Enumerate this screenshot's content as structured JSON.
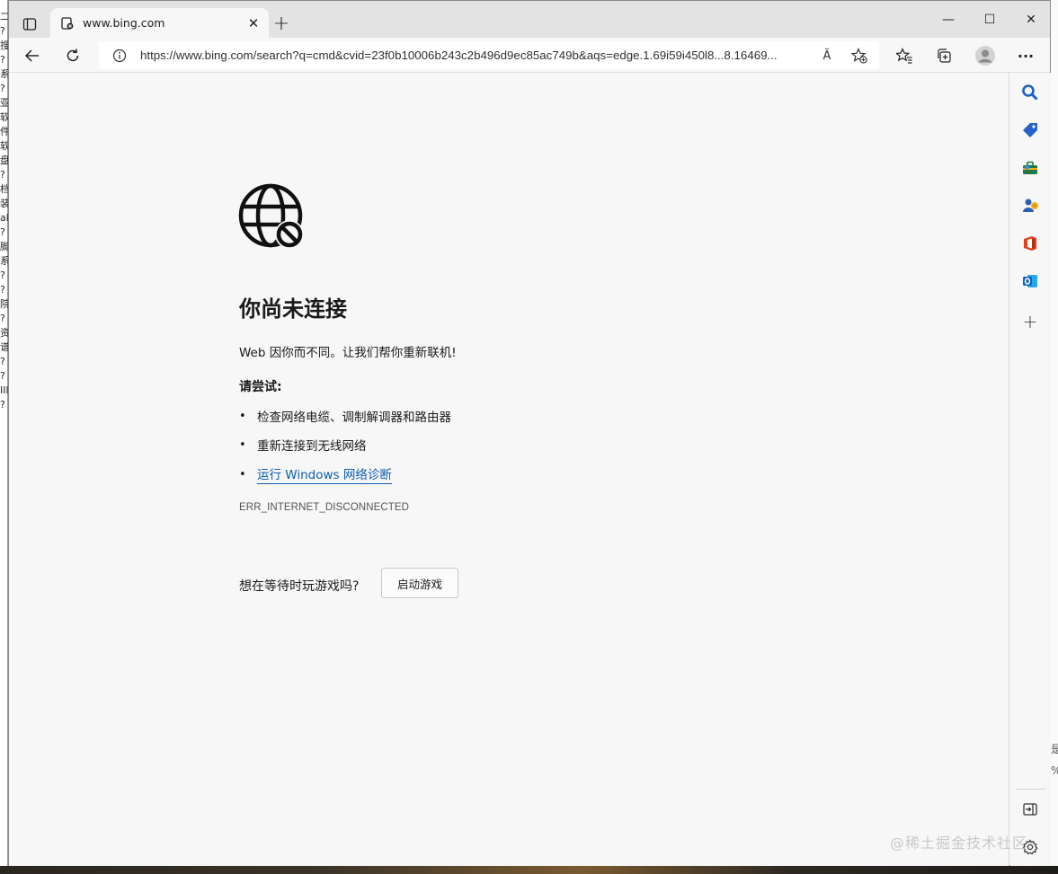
{
  "desktop": {
    "left_glyphs": [
      "二",
      "?",
      "搜",
      "?",
      "系",
      "?",
      "亚",
      "软",
      "件",
      "软",
      "盘",
      "?",
      "档",
      "装",
      "ak",
      "?",
      "脚",
      "系",
      "?",
      "?",
      "院",
      "?",
      "资",
      "谱",
      "?",
      "?",
      "IIl",
      "?"
    ],
    "right_glyphs": [
      "是",
      "%"
    ]
  },
  "browser": {
    "tab": {
      "title": "www.bing.com",
      "close_glyph": "✕"
    },
    "new_tab_glyph": "+",
    "window_controls": {
      "minimize": "—",
      "maximize": "☐",
      "close": "✕"
    },
    "address": {
      "url": "https://www.bing.com/search?q=cmd&cvid=23f0b10006b243c2b496d9ec85ac749b&aqs=edge.1.69i59i450l8...8.16469...",
      "read_aloud_glyph": "Ã"
    },
    "more_glyph": "···"
  },
  "error_page": {
    "heading": "你尚未连接",
    "subtext": "Web 因你而不同。让我们帮你重新联机!",
    "try_title": "请尝试:",
    "suggestions": [
      {
        "text": "检查网络电缆、调制解调器和路由器",
        "is_link": false
      },
      {
        "text": "重新连接到无线网络",
        "is_link": false
      },
      {
        "text": "运行 Windows 网络诊断",
        "is_link": true
      }
    ],
    "bullet": "•",
    "error_code": "ERR_INTERNET_DISCONNECTED",
    "game_question": "想在等待时玩游戏吗?",
    "game_button": "启动游戏"
  },
  "sidebar": {
    "add_glyph": "+",
    "colors": {
      "search": "#1b5fc9",
      "shopping": "#2563c9",
      "tools": "#1f7a4a",
      "games": "#2a5fb5",
      "office": "#e0401c",
      "outlook": "#0a64c9"
    }
  },
  "watermark": "@稀土掘金技术社区",
  "colors": {
    "link": "#0b5cad",
    "page_bg": "#f7f7f7",
    "titlebar_bg": "#e3e3e3"
  }
}
